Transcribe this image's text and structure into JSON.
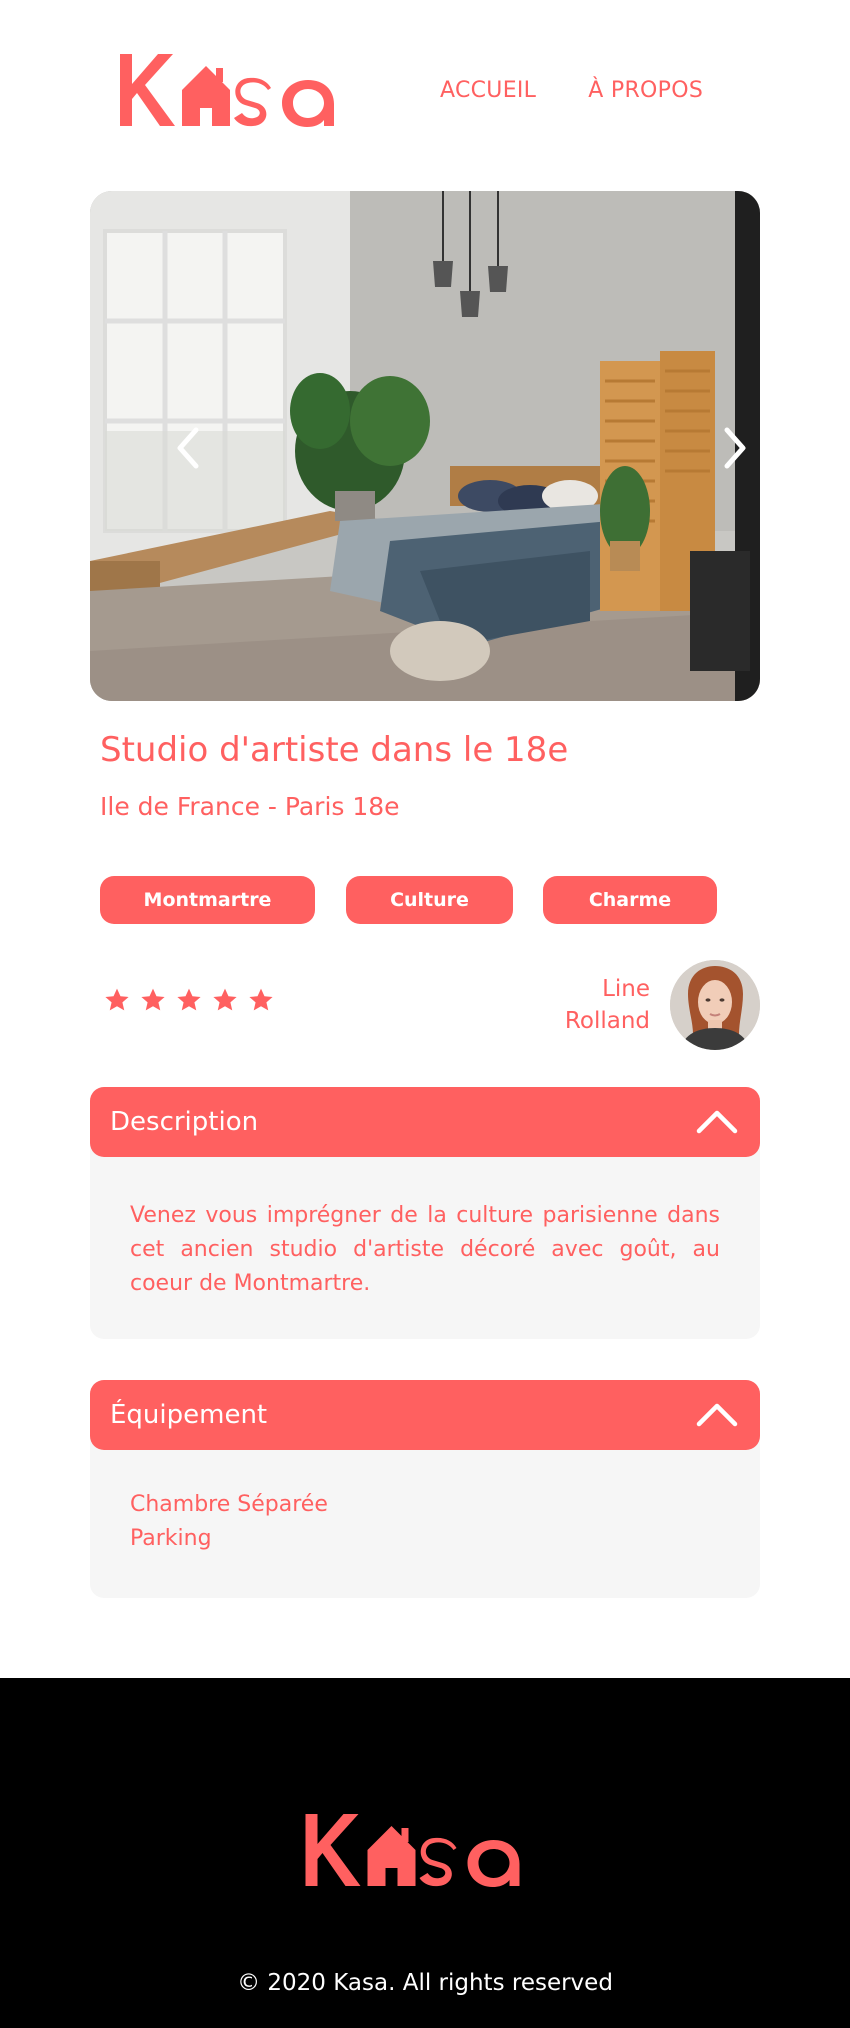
{
  "brand": {
    "logo_text": "Kasa",
    "color": "#FF6060"
  },
  "nav": {
    "home": "ACCUEIL",
    "about": "À PROPOS"
  },
  "listing": {
    "title": "Studio d'artiste dans le 18e",
    "location": "Ile de France - Paris 18e",
    "tags": [
      "Montmartre",
      "Culture",
      "Charme"
    ],
    "rating": 5,
    "host": {
      "first_name": "Line",
      "last_name": "Rolland"
    }
  },
  "description": {
    "title": "Description",
    "text": "Venez vous imprégner de la culture parisienne dans cet ancien studio d'artiste décoré avec goût, au coeur de Montmartre."
  },
  "equipment": {
    "title": "Équipement",
    "items": [
      "Chambre Séparée",
      "Parking"
    ]
  },
  "footer": {
    "copyright": "© 2020 Kasa. All rights reserved"
  },
  "icons": {
    "gallery_prev": "chevron-left-icon",
    "gallery_next": "chevron-right-icon",
    "collapse_toggle": "chevron-up-icon",
    "rating": "star-icon",
    "logo_house": "house-icon"
  }
}
